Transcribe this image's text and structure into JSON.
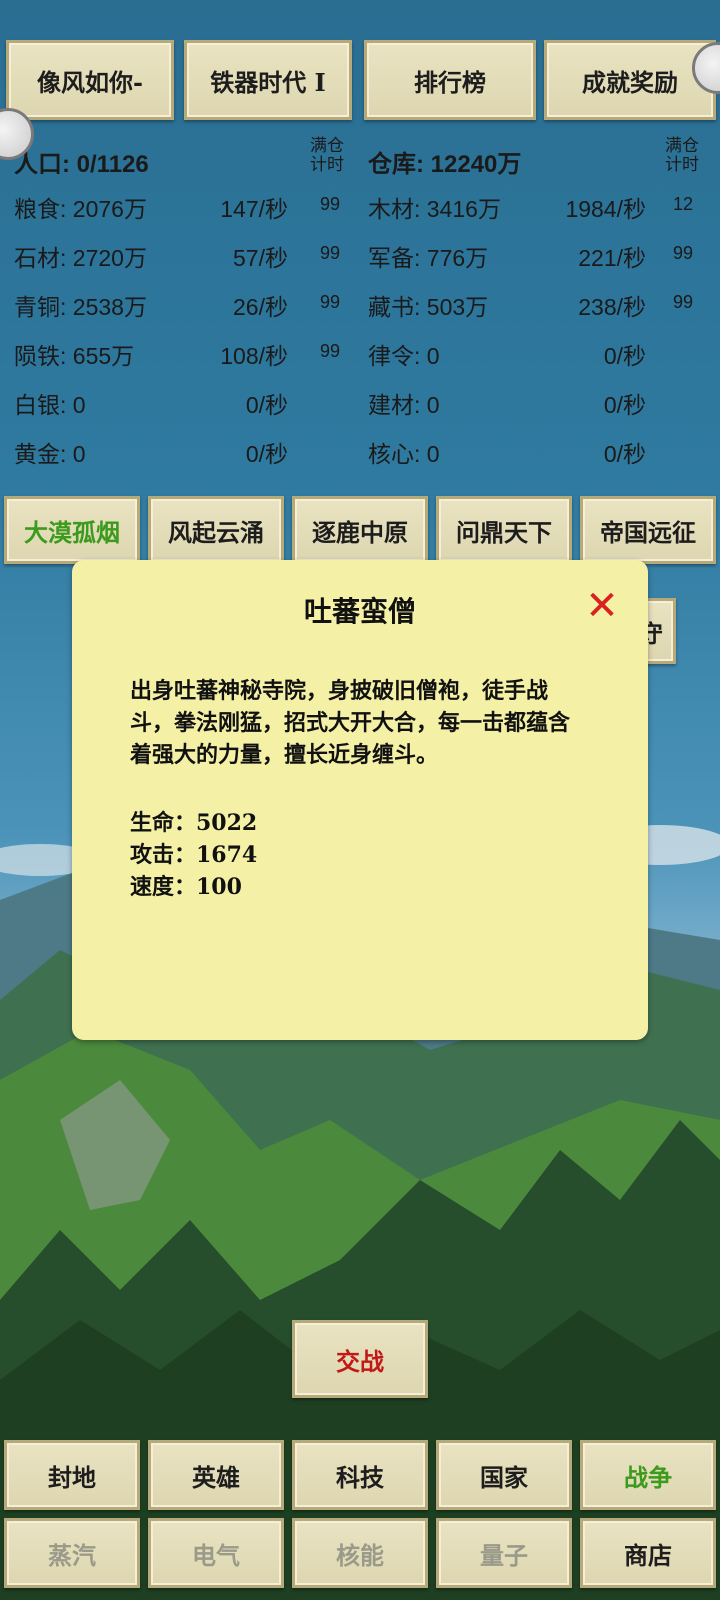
{
  "top_nav": [
    "像风如你-",
    "铁器时代 I",
    "排行榜",
    "成就奖励"
  ],
  "stats_header": {
    "left_label": "人口: 0/1126",
    "left_full": [
      "满仓",
      "计时"
    ],
    "right_label": "仓库: 12240万",
    "right_full": [
      "满仓",
      "计时"
    ]
  },
  "resources": [
    {
      "name": "粮食: 2076万",
      "rate": "147/秒",
      "full": "99",
      "name2": "木材: 3416万",
      "rate2": "1984/秒",
      "full2": "12"
    },
    {
      "name": "石材: 2720万",
      "rate": "57/秒",
      "full": "99",
      "name2": "军备: 776万",
      "rate2": "221/秒",
      "full2": "99"
    },
    {
      "name": "青铜: 2538万",
      "rate": "26/秒",
      "full": "99",
      "name2": "藏书: 503万",
      "rate2": "238/秒",
      "full2": "99"
    },
    {
      "name": "陨铁: 655万",
      "rate": "108/秒",
      "full": "99",
      "name2": "律令: 0",
      "rate2": "0/秒",
      "full2": ""
    },
    {
      "name": "白银: 0",
      "rate": "0/秒",
      "full": "",
      "name2": "建材: 0",
      "rate2": "0/秒",
      "full2": ""
    },
    {
      "name": "黄金: 0",
      "rate": "0/秒",
      "full": "",
      "name2": "核心: 0",
      "rate2": "0/秒",
      "full2": ""
    }
  ],
  "chapter_tabs": [
    "大漠孤烟",
    "风起云涌",
    "逐鹿中原",
    "问鼎天下",
    "帝国远征"
  ],
  "partial_button": "守",
  "modal": {
    "title": "吐蕃蛮僧",
    "close_icon": "close-x-icon",
    "description": "出身吐蕃神秘寺院，身披破旧僧袍，徒手战斗，拳法刚猛，招式大开大合，每一击都蕴含着强大的力量，擅长近身缠斗。",
    "hp": "生命：5022",
    "attack": "攻击：1674",
    "speed": "速度：100"
  },
  "fight_button": "交战",
  "bottom_nav_row1": [
    "封地",
    "英雄",
    "科技",
    "国家",
    "战争"
  ],
  "bottom_nav_row2": [
    "蒸汽",
    "电气",
    "核能",
    "量子",
    "商店"
  ],
  "colors": {
    "active_green": "#3c9a1c",
    "fight_red": "#c21818",
    "disabled_gray": "#9a9a8a",
    "modal_bg": "#f4f1a7",
    "close_red": "#d8221f"
  }
}
